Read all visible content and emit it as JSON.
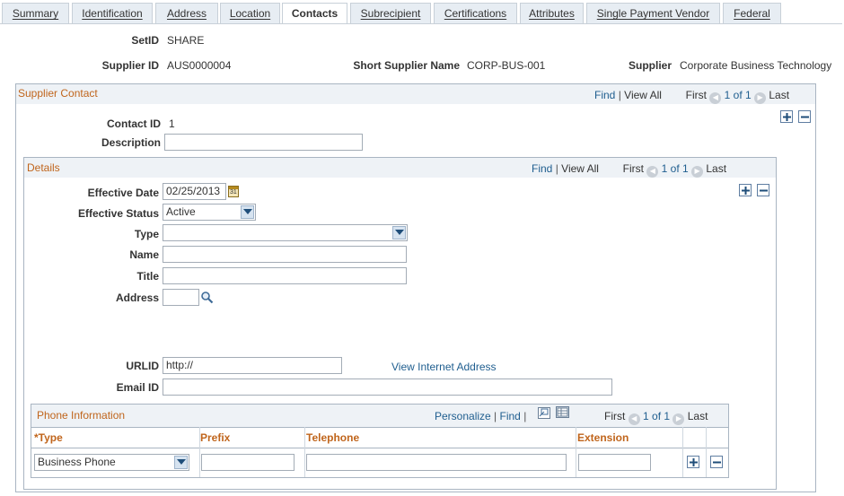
{
  "tabs": [
    {
      "label": "Summary"
    },
    {
      "label": "Identification"
    },
    {
      "label": "Address"
    },
    {
      "label": "Location"
    },
    {
      "label": "Contacts"
    },
    {
      "label": "Subrecipient"
    },
    {
      "label": "Certifications"
    },
    {
      "label": "Attributes"
    },
    {
      "label": "Single Payment Vendor"
    },
    {
      "label": "Federal"
    }
  ],
  "header": {
    "setid_label": "SetID",
    "setid_value": "SHARE",
    "supplier_id_label": "Supplier ID",
    "supplier_id_value": "AUS0000004",
    "short_name_label": "Short Supplier Name",
    "short_name_value": "CORP-BUS-001",
    "supplier_label": "Supplier",
    "supplier_value": "Corporate Business Technology"
  },
  "supplier_contact": {
    "title": "Supplier Contact",
    "find": "Find",
    "sep": "|",
    "view_all": "View All",
    "first": "First",
    "range": "1 of 1",
    "last": "Last",
    "contact_id_label": "Contact ID",
    "contact_id_value": "1",
    "description_label": "Description",
    "description_value": ""
  },
  "details": {
    "title": "Details",
    "find": "Find",
    "sep": "|",
    "view_all": "View All",
    "first": "First",
    "range": "1 of 1",
    "last": "Last",
    "effective_date_label": "Effective Date",
    "effective_date_value": "02/25/2013",
    "effective_status_label": "Effective Status",
    "effective_status_value": "Active",
    "type_label": "Type",
    "type_value": "",
    "name_label": "Name",
    "name_value": "",
    "title_label": "Title",
    "title_value": "",
    "address_label": "Address",
    "address_value": "",
    "urlid_label": "URLID",
    "urlid_value": "http://",
    "view_internet_address": "View Internet Address",
    "email_label": "Email ID",
    "email_value": ""
  },
  "phone": {
    "title": "Phone Information",
    "personalize": "Personalize",
    "find": "Find",
    "sep": "|",
    "first": "First",
    "range": "1 of 1",
    "last": "Last",
    "columns": [
      "*Type",
      "Prefix",
      "Telephone",
      "Extension"
    ],
    "row": {
      "type": "Business Phone",
      "prefix": "",
      "telephone": "",
      "extension": ""
    }
  },
  "colors": {
    "accent": "#c0651c",
    "link": "#1f5e8f",
    "border": "#a9b5c2",
    "tab_bg": "#e7edf3"
  }
}
